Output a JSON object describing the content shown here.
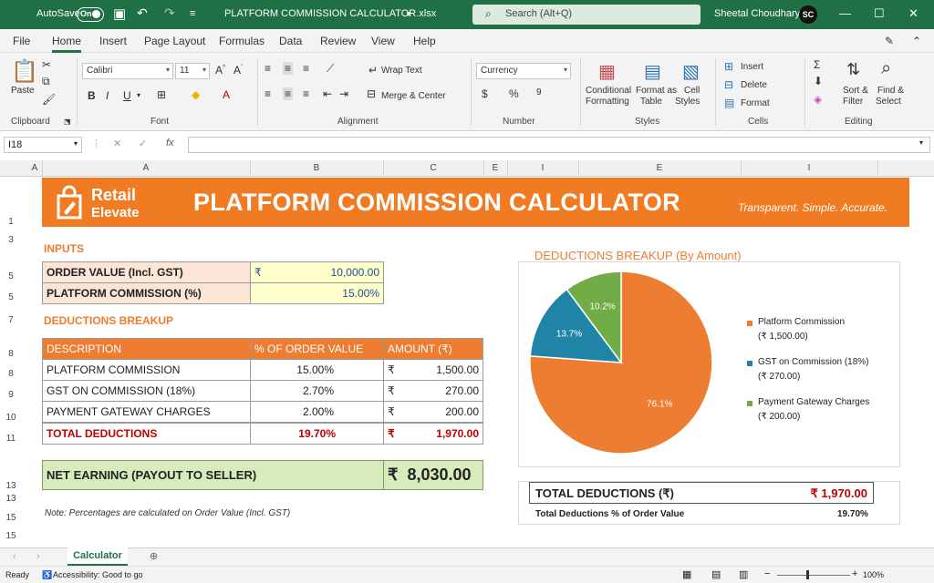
{
  "titlebar": {
    "autosave_label": "AutoSave",
    "autosave_state": "On",
    "filename": "PLATFORM COMMISSION CALCULATOR.xlsx",
    "search_placeholder": "Search (Alt+Q)",
    "user_name": "Sheetal Choudhary",
    "user_initials": "SC"
  },
  "menu": [
    "File",
    "Home",
    "Insert",
    "Page Layout",
    "Formulas",
    "Data",
    "Review",
    "View",
    "Help"
  ],
  "ribbon": {
    "paste": "Paste",
    "clipboard": "Clipboard",
    "font_name": "Calibri",
    "font_size": "11",
    "font_group": "Font",
    "wrap_text": "Wrap Text",
    "merge_center": "Merge & Center",
    "alignment_group": "Alignment",
    "number_format": "Currency",
    "number_group": "Number",
    "conditional_formatting_1": "Conditional",
    "conditional_formatting_2": "Formatting",
    "format_as_table_1": "Format as",
    "format_as_table_2": "Table",
    "cell_styles_1": "Cell",
    "cell_styles_2": "Styles",
    "styles_group": "Styles",
    "insert": "Insert",
    "delete": "Delete",
    "format": "Format",
    "cells_group": "Cells",
    "sort_filter_1": "Sort &",
    "sort_filter_2": "Filter",
    "find_select_1": "Find &",
    "find_select_2": "Select",
    "editing_group": "Editing"
  },
  "formula_bar": {
    "name_box": "I18",
    "fx": "fx",
    "content": ""
  },
  "columns": [
    "A",
    "A",
    "B",
    "C",
    "E",
    "I",
    "E",
    "I"
  ],
  "rows": [
    "1",
    "3",
    "5",
    "5",
    "7",
    "8",
    "8",
    "9",
    "10",
    "11",
    "13",
    "13",
    "15",
    "15"
  ],
  "banner": {
    "logo_line1": "Retail",
    "logo_line2": "Elevate",
    "title": "PLATFORM COMMISSION CALCULATOR",
    "tagline": "Transparent. Simple. Accurate."
  },
  "inputs": {
    "heading": "INPUTS",
    "order_value_label": "ORDER VALUE (Incl. GST)",
    "currency_symbol": "₹",
    "order_value": "10,000.00",
    "commission_label": "PLATFORM COMMISSION (%)",
    "commission_value": "15.00%"
  },
  "breakup": {
    "heading": "DEDUCTIONS BREAKUP",
    "headers": [
      "DESCRIPTION",
      "% OF ORDER VALUE",
      "AMOUNT (₹)"
    ],
    "rows": [
      {
        "desc": "PLATFORM COMMISSION",
        "pct": "15.00%",
        "cur": "₹",
        "amt": "1,500.00"
      },
      {
        "desc": "GST ON COMMISSION (18%)",
        "pct": "2.70%",
        "cur": "₹",
        "amt": "270.00"
      },
      {
        "desc": "PAYMENT GATEWAY CHARGES",
        "pct": "2.00%",
        "cur": "₹",
        "amt": "200.00"
      }
    ],
    "total": {
      "desc": "TOTAL DEDUCTIONS",
      "pct": "19.70%",
      "cur": "₹",
      "amt": "1,970.00"
    }
  },
  "net": {
    "label": "NET EARNING (PAYOUT TO SELLER)",
    "cur": "₹",
    "amount": "8,030.00"
  },
  "note": "Note: Percentages are calculated on Order Value (Incl. GST)",
  "chart_data": {
    "type": "pie",
    "title": "DEDUCTIONS BREAKUP (By Amount)",
    "categories": [
      "Platform Commission",
      "GST on Commission (18%)",
      "Payment Gateway Charges"
    ],
    "legend_values": [
      "(₹ 1,500.00)",
      "(₹ 270.00)",
      "(₹ 200.00)"
    ],
    "values": [
      1500,
      270,
      200
    ],
    "labels": [
      "76.1%",
      "13.7%",
      "10.2%"
    ],
    "colors": [
      "#ed7d31",
      "#2084a6",
      "#70ad47"
    ],
    "legend_position": "right"
  },
  "summary": {
    "total_label": "TOTAL DEDUCTIONS (₹)",
    "total_value": "₹ 1,970.00",
    "pct_label": "Total Deductions % of Order Value",
    "pct_value": "19.70%"
  },
  "sheet_tab": "Calculator",
  "status": {
    "ready": "Ready",
    "accessibility": "Accessibility: Good to go",
    "zoom": "100%"
  }
}
